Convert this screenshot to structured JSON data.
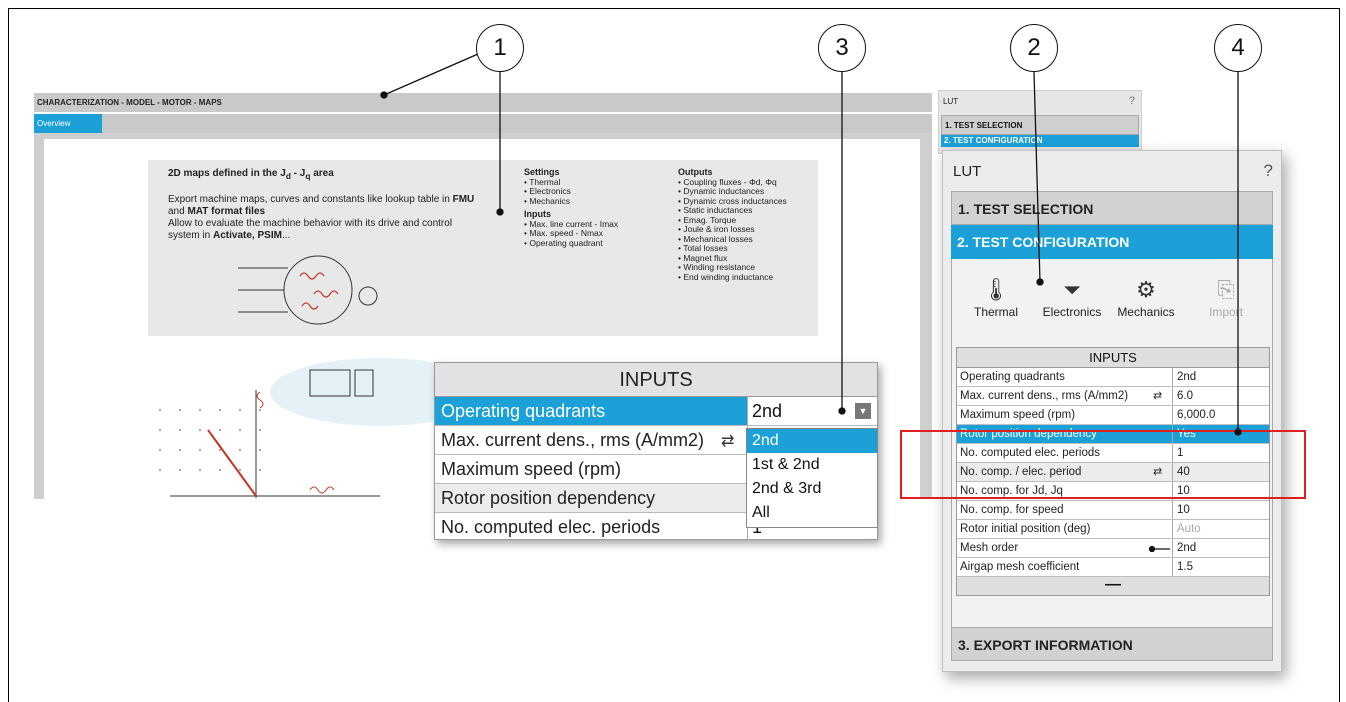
{
  "callouts": [
    "1",
    "3",
    "2",
    "4"
  ],
  "main": {
    "title": "CHARACTERIZATION - MODEL - MOTOR - MAPS",
    "tab": "Overview",
    "description": {
      "title": "2D maps defined in the J",
      "title_sub1": "d",
      "title_mid": " - J",
      "title_sub2": "q",
      "title_tail": " area",
      "line1": "Export machine maps, curves and constants like lookup table in ",
      "line1_b1": "FMU",
      "line1_mid": " and ",
      "line1_b2": "MAT format files",
      "line2": "Allow to evaluate the machine behavior with its drive and control system in ",
      "line2_b": "Activate, PSIM",
      "line2_tail": "...",
      "settings_head": "Settings",
      "settings": [
        "Thermal",
        "Electronics",
        "Mechanics"
      ],
      "inputs_head": "Inputs",
      "inputs": [
        "Max. line current - Imax",
        "Max. speed - Nmax",
        "Operating quadrant"
      ],
      "outputs_head": "Outputs",
      "outputs": [
        "Coupling fluxes - Φd, Φq",
        "Dynamic inductances",
        "Dynamic cross inductances",
        "Static inductances",
        "Emag. Torque",
        "Joule & iron losses",
        "Mechanical losses",
        "Total losses",
        "Magnet flux",
        "Winding resistance",
        "End winding inductance"
      ]
    }
  },
  "zoom_inputs": {
    "header": "INPUTS",
    "rows": [
      {
        "label": "Operating quadrants",
        "value": "2nd"
      },
      {
        "label": "Max. current dens., rms (A/mm2)",
        "value": ""
      },
      {
        "label": "Maximum speed (rpm)",
        "value": ""
      },
      {
        "label": "Rotor position dependency",
        "value": ""
      },
      {
        "label": "No. computed elec. periods",
        "value": "1"
      }
    ],
    "dropdown_options": [
      "2nd",
      "1st & 2nd",
      "2nd & 3rd",
      "All"
    ]
  },
  "lut_small": {
    "title": "LUT",
    "help": "?",
    "section1": "1. TEST SELECTION",
    "section2": "2. TEST CONFIGURATION"
  },
  "lut": {
    "title": "LUT",
    "help": "?",
    "section1": "1. TEST SELECTION",
    "section2": "2. TEST CONFIGURATION",
    "section3": "3. EXPORT INFORMATION",
    "tools": [
      {
        "label": "Thermal",
        "icon": "thermometer-icon"
      },
      {
        "label": "Electronics",
        "icon": "diode-icon"
      },
      {
        "label": "Mechanics",
        "icon": "gears-icon"
      },
      {
        "label": "Import",
        "icon": "import-icon"
      }
    ],
    "inputs_header": "INPUTS",
    "inputs": [
      {
        "label": "Operating quadrants",
        "value": "2nd"
      },
      {
        "label": "Max. current dens., rms (A/mm2)",
        "value": "6.0"
      },
      {
        "label": "Maximum speed (rpm)",
        "value": "6,000.0"
      },
      {
        "label": "Rotor position dependency",
        "value": "Yes"
      },
      {
        "label": "No. computed elec. periods",
        "value": "1"
      },
      {
        "label": "No. comp. / elec. period",
        "value": "40"
      },
      {
        "label": "No. comp. for Jd, Jq",
        "value": "10"
      },
      {
        "label": "No. comp. for speed",
        "value": "10"
      },
      {
        "label": "Rotor initial position (deg)",
        "value": "Auto"
      },
      {
        "label": "Mesh order",
        "value": "2nd"
      },
      {
        "label": "Airgap mesh coefficient",
        "value": "1.5"
      }
    ],
    "collapse": "—"
  },
  "colors": {
    "accent": "#1ba0d8",
    "highlight": "#e02020",
    "panel": "#ececec"
  }
}
